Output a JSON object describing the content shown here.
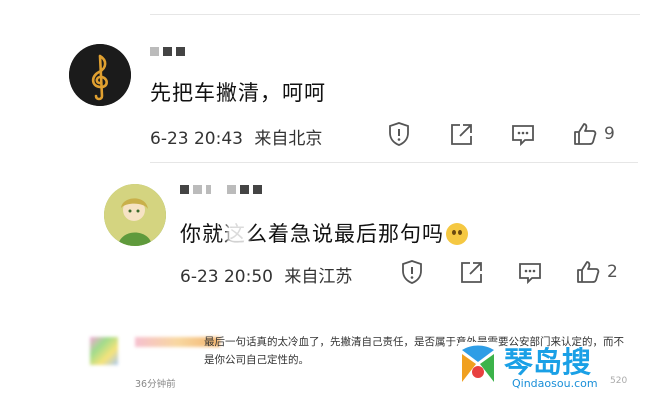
{
  "comments": [
    {
      "text": "先把车撇清，呵呵",
      "date": "6-23 20:43",
      "location": "来自北京",
      "likes": "9"
    },
    {
      "text": "你就这么着急说最后那句吗",
      "date": "6-23 20:50",
      "location": "来自江苏",
      "likes": "2"
    }
  ],
  "bottom_comment": {
    "text": "最后一句话真的太冷血了，先撇清自己责任，是否属于意外是需要公安部门来认定的，而不是你公司自己定性的。",
    "time": "36分钟前",
    "count": "520"
  },
  "watermark": {
    "title": "琴岛搜",
    "url": "Qindaosou.com"
  },
  "icons": {
    "report": "report-icon",
    "share": "share-icon",
    "comment": "comment-icon",
    "like": "thumbs-up-icon"
  },
  "colors": {
    "watermark_blue": "#1aa0e6"
  }
}
